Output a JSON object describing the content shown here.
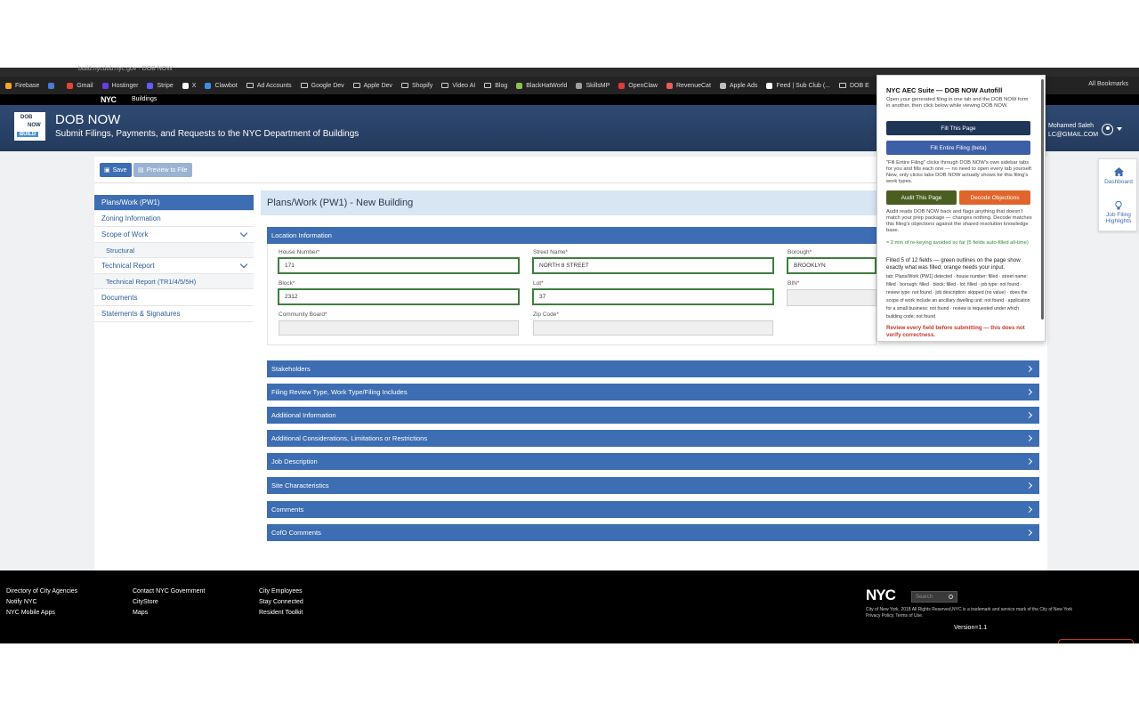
{
  "browser": {
    "tab_title": "build.nycdob.nyc.gov · DOB NOW",
    "bookmarks": [
      {
        "label": "Firebase",
        "type": "site",
        "color": "#f5a623"
      },
      {
        "label": "",
        "type": "site",
        "color": "#4a7bd0"
      },
      {
        "label": "Gmail",
        "type": "site",
        "color": "#ea4335"
      },
      {
        "label": "Hostinger",
        "type": "site",
        "color": "#673de6"
      },
      {
        "label": "Stripe",
        "type": "site",
        "color": "#635bff"
      },
      {
        "label": "X",
        "type": "site",
        "color": "#ffffff"
      },
      {
        "label": "Clawbot",
        "type": "site",
        "color": "#3a8ee6"
      },
      {
        "label": "Ad Accounts",
        "type": "folder"
      },
      {
        "label": "Google Dev",
        "type": "folder"
      },
      {
        "label": "Apple Dev",
        "type": "folder"
      },
      {
        "label": "Shopify",
        "type": "folder"
      },
      {
        "label": "Video AI",
        "type": "folder"
      },
      {
        "label": "Blog",
        "type": "folder"
      },
      {
        "label": "BlackHatWorld",
        "type": "site",
        "color": "#8bc34a"
      },
      {
        "label": "SkillsMP",
        "type": "site",
        "color": "#9e9e9e"
      },
      {
        "label": "OpenClaw",
        "type": "site",
        "color": "#e53935"
      },
      {
        "label": "RevenueCat",
        "type": "site",
        "color": "#f25a5a"
      },
      {
        "label": "Apple Ads",
        "type": "site",
        "color": "#bdbdbd"
      },
      {
        "label": "Feed | Sub Club (...",
        "type": "site",
        "color": "#ffffff"
      },
      {
        "label": "DOB E",
        "type": "folder"
      }
    ],
    "all_bookmarks": "All Bookmarks"
  },
  "nycbar": {
    "logo": "NYC",
    "section": "Buildings"
  },
  "header": {
    "title": "DOB NOW",
    "subtitle": "Submit Filings, Payments, and Requests to the NYC Department of Buildings",
    "logo_l1": "DOB",
    "logo_l2": "NOW",
    "logo_l3": "BUILD",
    "user_name": "Mohamed Saleh",
    "user_email": "LC@GMAIL.COM"
  },
  "toolbar": {
    "save_label": "Save",
    "preview_label": "Preview to File"
  },
  "sidebar": {
    "items": [
      {
        "label": "Plans/Work (PW1)",
        "active": true
      },
      {
        "label": "Zoning Information"
      },
      {
        "label": "Scope of Work",
        "expandable": true
      },
      {
        "label": "Structural",
        "sub": true
      },
      {
        "label": "Technical Report",
        "expandable": true
      },
      {
        "label": "Technical Report (TR1/4/5/5H)",
        "sub": true
      },
      {
        "label": "Documents"
      },
      {
        "label": "Statements & Signatures"
      }
    ]
  },
  "page": {
    "title": "Plans/Work (PW1) - New Building",
    "location_section": "Location Information",
    "fields": {
      "house_number": {
        "label": "House Number",
        "value": "171"
      },
      "street_name": {
        "label": "Street Name",
        "value": "NORTH 8 STREET"
      },
      "borough": {
        "label": "Borough",
        "value": "BROOKLYN"
      },
      "block": {
        "label": "Block",
        "value": "2312"
      },
      "lot": {
        "label": "Lot",
        "value": "37"
      },
      "bin": {
        "label": "BIN",
        "value": ""
      },
      "community_board": {
        "label": "Community Board",
        "value": ""
      },
      "zip_code": {
        "label": "Zip Code",
        "value": ""
      }
    },
    "required_mark": "*",
    "sections": [
      "Stakeholders",
      "Filing Review Type, Work Type/Filing Includes",
      "Additional Information",
      "Additional Considerations, Limitations or Restrictions",
      "Job Description",
      "Site Characteristics",
      "Comments",
      "CofO Comments"
    ]
  },
  "popup": {
    "title": "NYC AEC Suite — DOB NOW Autofill",
    "intro": "Open your generated filing in one tab and the DOB NOW form in another, then click below while viewing DOB NOW.",
    "fill_page": "Fill This Page",
    "fill_entire": "Fill Entire Filing (beta)",
    "note1": "\"Fill Entire Filing\" clicks through DOB NOW's own sidebar tabs for you and fills each one — no need to open every tab yourself. New, only clicks tabs DOB NOW actually shows for this filing's work types.",
    "audit": "Audit This Page",
    "decode": "Decode Objections",
    "note2": "Audit reads DOB NOW back and flags anything that doesn't match your prep package — changes nothing. Decode matches this filing's objections against the shared resolution knowledge base.",
    "saved": "≈ 2 min of re-keying avoided so far (5 fields auto-filled all-time)",
    "filled": "Filled 5 of 12 fields — green outlines on the page show exactly what was filled; orange needs your input.",
    "detail": "tab: Plans/Work (PW1) detected · house number: filled · street name: filled · borough: filled · block: filled · lot: filled · job type: not found · review type: not found · job description: skipped (no value) · does the scope of work include an ancillary dwelling unit: not found · application for a small business: not found · review is requested under which building code: not found",
    "warning": "Review every field before submitting — this does not verify correctness.",
    "colors": {
      "dark": "#1f3556",
      "blue": "#3d5fa8",
      "olive": "#4b5e22",
      "orange": "#e0652a"
    }
  },
  "rail": {
    "dashboard": "Dashboard",
    "highlights": "Job Filing Highlights"
  },
  "footer": {
    "col1": [
      "Directory of City Agencies",
      "Notify NYC",
      "NYC Mobile Apps"
    ],
    "col2": [
      "Contact NYC Government",
      "CityStore",
      "Maps"
    ],
    "col3": [
      "City Employees",
      "Stay Connected",
      "Resident Toolkit"
    ],
    "logo": "NYC",
    "search_placeholder": "Search",
    "copyright": "City of New York. 2018 All Rights Reserved,NYC is a trademark and service mark of the City of New York",
    "privacy": "Privacy Policy. Terms of Use.",
    "version": "Version=1.1"
  }
}
